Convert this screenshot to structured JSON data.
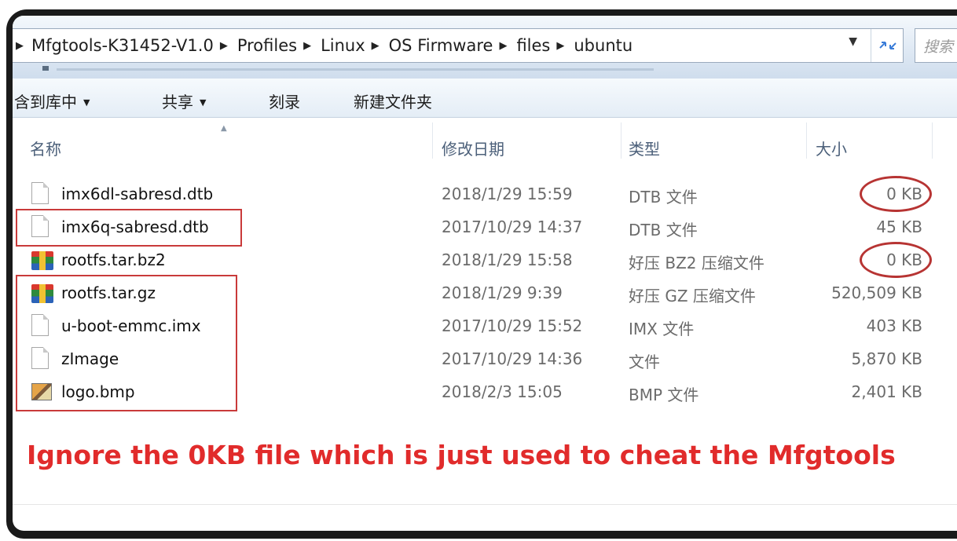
{
  "breadcrumb": [
    "Mfgtools-K31452-V1.0",
    "Profiles",
    "Linux",
    "OS Firmware",
    "files",
    "ubuntu"
  ],
  "search": {
    "placeholder": "搜索"
  },
  "toolbar": {
    "include_library": "含到库中",
    "share": "共享",
    "burn": "刻录",
    "new_folder": "新建文件夹"
  },
  "columns": {
    "name": "名称",
    "modified": "修改日期",
    "type": "类型",
    "size": "大小"
  },
  "files": [
    {
      "name": "imx6dl-sabresd.dtb",
      "modified": "2018/1/29 15:59",
      "type": "DTB 文件",
      "size": "0 KB",
      "icon": "document-icon"
    },
    {
      "name": "imx6q-sabresd.dtb",
      "modified": "2017/10/29 14:37",
      "type": "DTB 文件",
      "size": "45 KB",
      "icon": "document-icon"
    },
    {
      "name": "rootfs.tar.bz2",
      "modified": "2018/1/29 15:58",
      "type": "好压 BZ2 压缩文件",
      "size": "0 KB",
      "icon": "archive-icon"
    },
    {
      "name": "rootfs.tar.gz",
      "modified": "2018/1/29 9:39",
      "type": "好压 GZ 压缩文件",
      "size": "520,509 KB",
      "icon": "archive-icon"
    },
    {
      "name": "u-boot-emmc.imx",
      "modified": "2017/10/29 15:52",
      "type": "IMX 文件",
      "size": "403 KB",
      "icon": "document-icon"
    },
    {
      "name": "zImage",
      "modified": "2017/10/29 14:36",
      "type": "文件",
      "size": "5,870 KB",
      "icon": "document-icon"
    },
    {
      "name": "logo.bmp",
      "modified": "2018/2/3 15:05",
      "type": "BMP 文件",
      "size": "2,401 KB",
      "icon": "bitmap-icon"
    }
  ],
  "annotation": {
    "caption": "Ignore the 0KB file which is just used to cheat the Mfgtools"
  },
  "colors": {
    "annotation_red": "#e12b2b",
    "highlight_box": "#c93a3a"
  }
}
